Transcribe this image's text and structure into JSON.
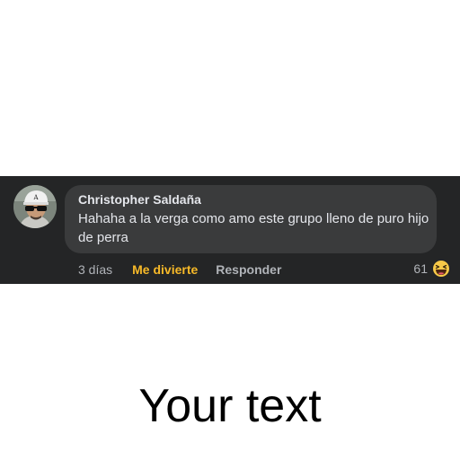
{
  "comment": {
    "author": "Christopher Saldaña",
    "text": "Hahaha a la verga como amo este grupo lleno de puro hijo de perra",
    "timestamp": "3 días",
    "reaction_label": "Me divierte",
    "reply_label": "Responder",
    "reaction_count": "61",
    "reaction_icon": "haha-emoji-icon"
  },
  "caption": {
    "text": "Your text"
  },
  "colors": {
    "panel_background": "#242526",
    "bubble_background": "#3a3b3c",
    "primary_text": "#e4e6eb",
    "secondary_text": "#b0b3b8",
    "reaction_accent": "#f7b928"
  }
}
